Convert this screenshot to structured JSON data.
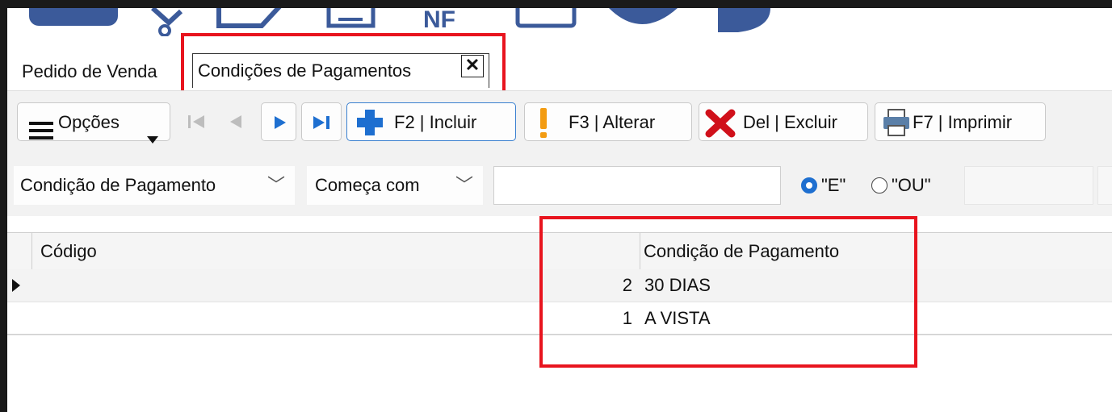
{
  "tabs": [
    {
      "label": "Pedido de Venda"
    },
    {
      "label": "Condições de Pagamentos"
    }
  ],
  "tab_close_symbol": "✕",
  "toolbar": {
    "options_label": "Opções",
    "nav_icons": [
      "first-icon",
      "prev-icon",
      "next-icon",
      "last-icon"
    ],
    "include_label": "F2 | Incluir",
    "edit_label": "F3 | Alterar",
    "delete_label": "Del | Excluir",
    "print_label": "F7 | Imprimir"
  },
  "filter": {
    "field_value": "Condição de Pagamento",
    "operator_value": "Começa com",
    "search_value": "",
    "radio_and_label": "\"E\"",
    "radio_or_label": "\"OU\"",
    "radio_selected": "E"
  },
  "grid": {
    "columns": [
      "Código",
      "Condição de Pagamento"
    ],
    "rows": [
      {
        "codigo": "2",
        "condicao": "30 DIAS"
      },
      {
        "codigo": "1",
        "condicao": "A VISTA"
      }
    ]
  },
  "colors": {
    "highlight_red": "#e8141e",
    "accent_blue": "#1e6fd0",
    "delete_red": "#d0101a",
    "warning_orange": "#f39c12"
  }
}
